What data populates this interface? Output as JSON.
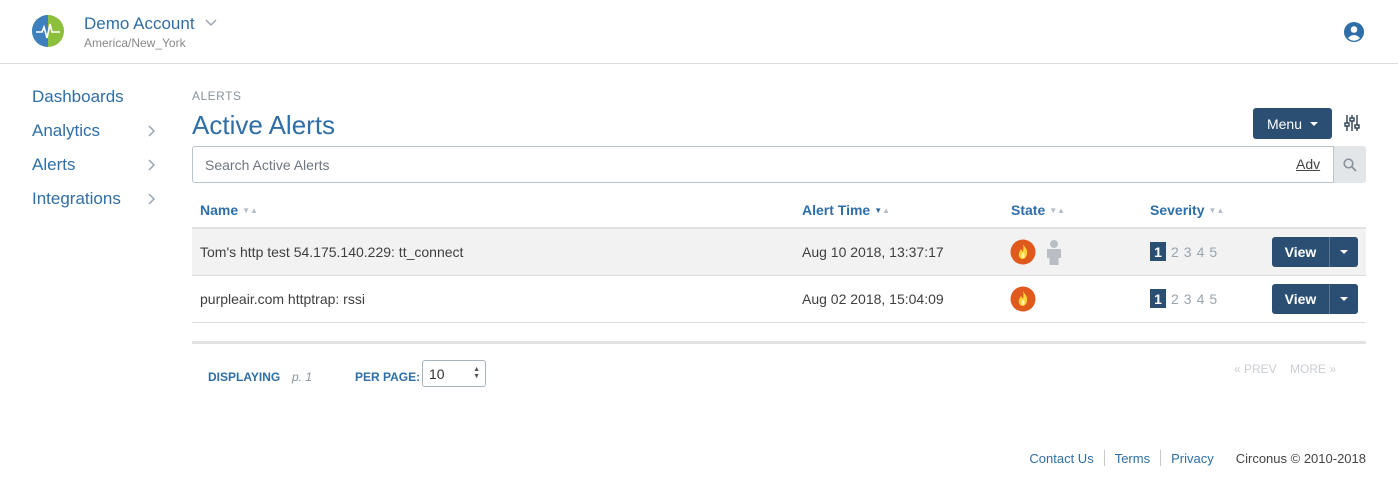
{
  "header": {
    "account_name": "Demo Account",
    "timezone": "America/New_York"
  },
  "sidebar": {
    "items": [
      {
        "label": "Dashboards",
        "has_chevron": false
      },
      {
        "label": "Analytics",
        "has_chevron": true
      },
      {
        "label": "Alerts",
        "has_chevron": true
      },
      {
        "label": "Integrations",
        "has_chevron": true
      }
    ]
  },
  "main": {
    "breadcrumb": "ALERTS",
    "title": "Active Alerts",
    "menu_label": "Menu",
    "search_placeholder": "Search Active Alerts",
    "adv_label": "Adv"
  },
  "table": {
    "columns": {
      "name": "Name",
      "alert_time": "Alert Time",
      "state": "State",
      "severity": "Severity"
    },
    "rows": [
      {
        "name": "Tom's http test 54.175.140.229: tt_connect",
        "time": "Aug 10 2018, 13:37:17",
        "states": [
          "fire-icon",
          "person-icon"
        ],
        "severity_active": "1",
        "view_label": "View"
      },
      {
        "name": "purpleair.com httptrap: rssi",
        "time": "Aug 02 2018, 15:04:09",
        "states": [
          "fire-icon"
        ],
        "severity_active": "1",
        "view_label": "View"
      }
    ],
    "severity_levels": [
      "1",
      "2",
      "3",
      "4",
      "5"
    ]
  },
  "pager": {
    "displaying_label": "DISPLAYING",
    "page": "p. 1",
    "per_page_label": "PER PAGE:",
    "per_page_value": "10",
    "prev_label": "« PREV",
    "more_label": "MORE »"
  },
  "footer": {
    "contact": "Contact Us",
    "terms": "Terms",
    "privacy": "Privacy",
    "copyright": "Circonus © 2010-2018"
  },
  "colors": {
    "accent": "#2f6ea6",
    "button": "#2b4f73",
    "fire": "#e05a1e"
  }
}
